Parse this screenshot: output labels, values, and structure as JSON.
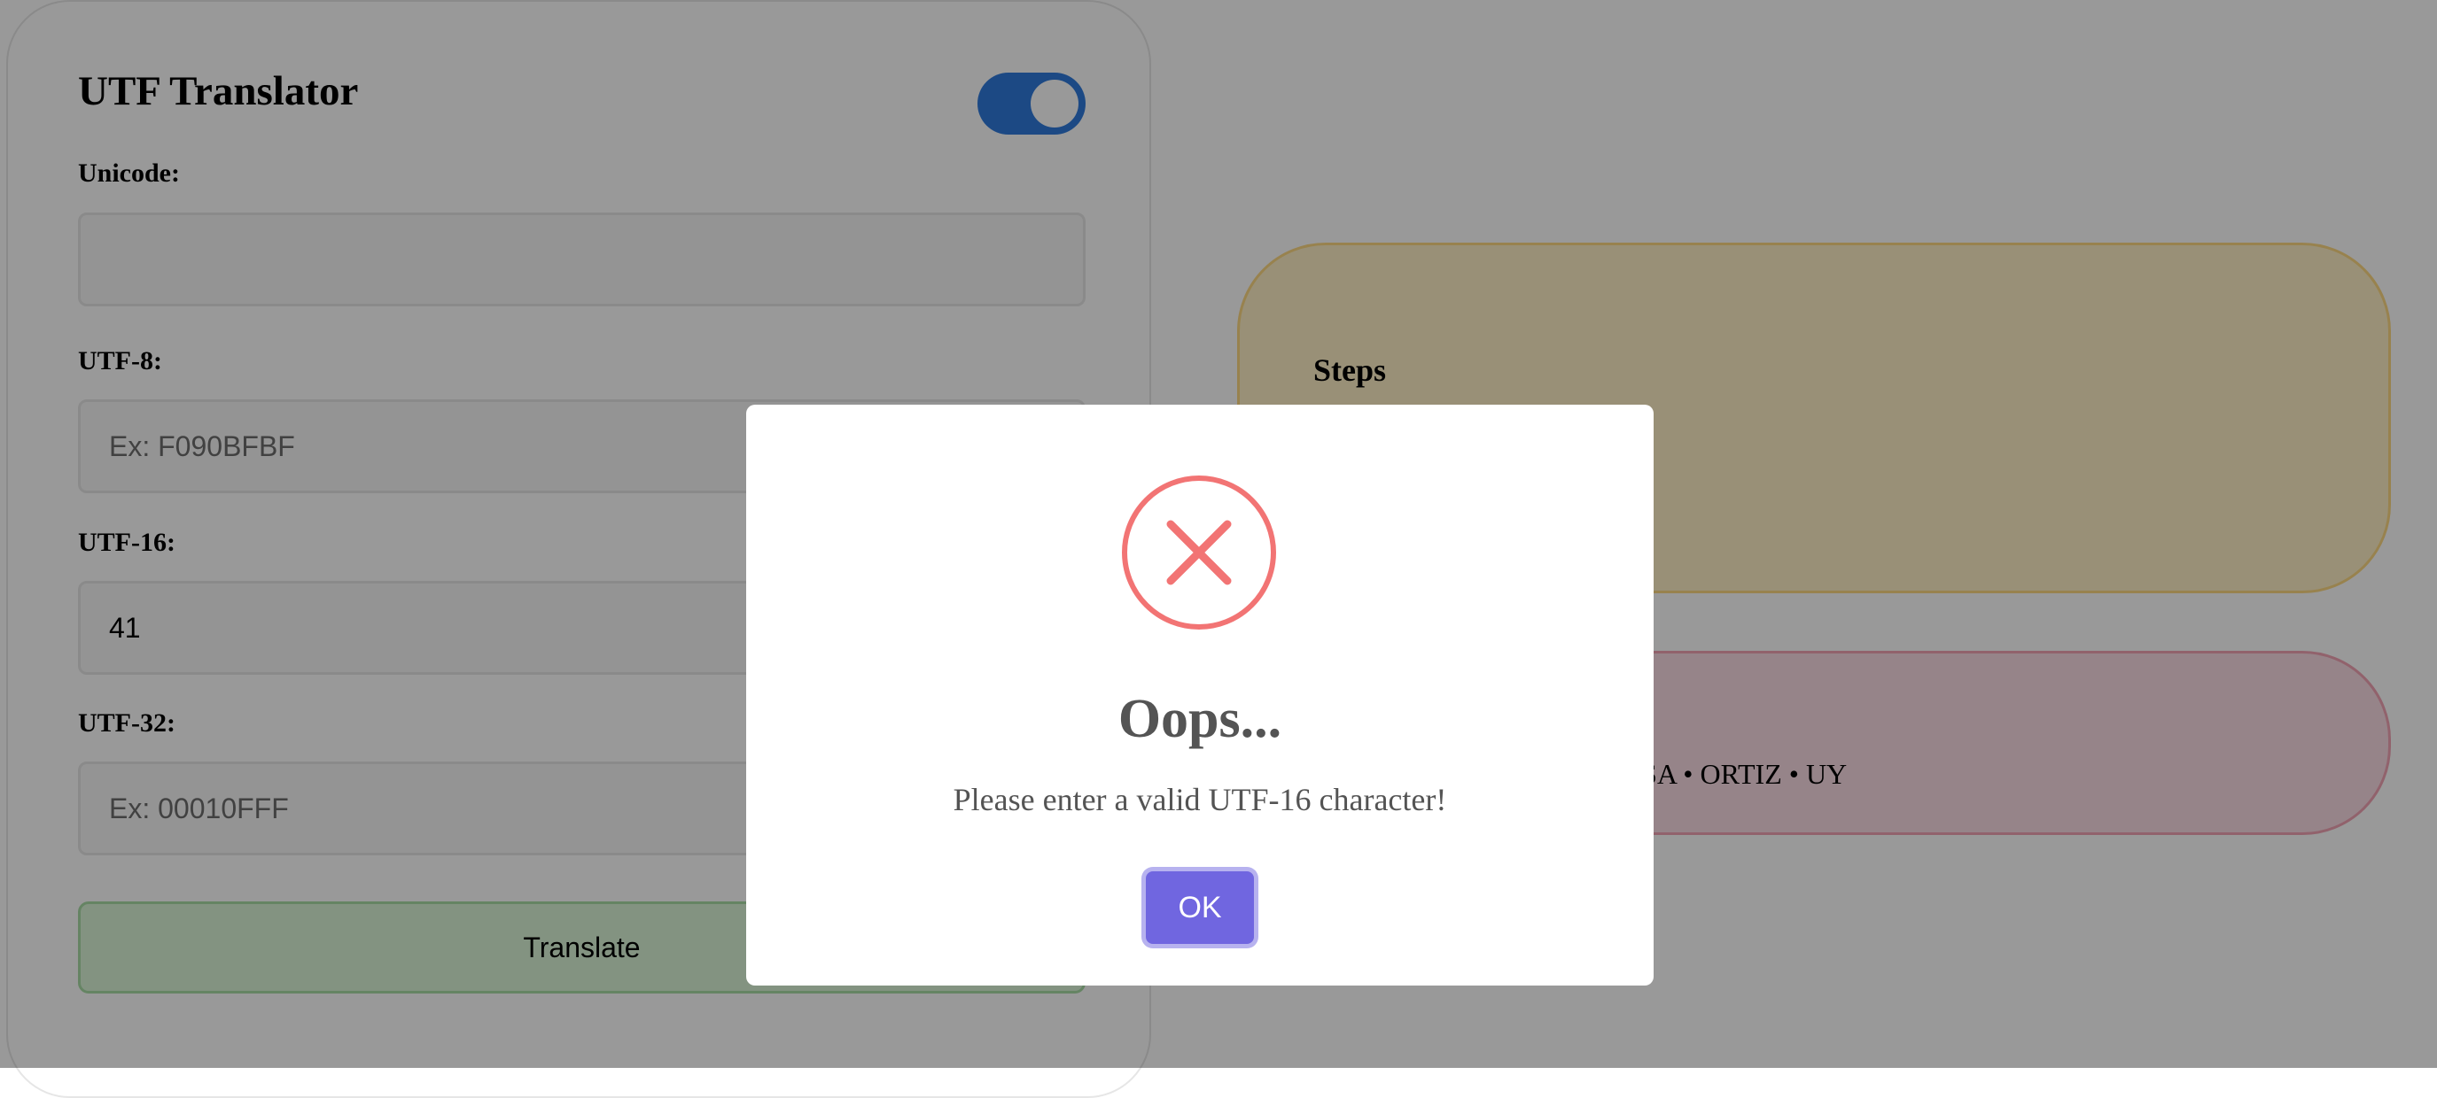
{
  "translator": {
    "title": "UTF Translator",
    "unicode_label": "Unicode:",
    "unicode_value": "",
    "unicode_placeholder": "",
    "utf8_label": "UTF-8:",
    "utf8_value": "",
    "utf8_placeholder": "Ex: F090BFBF",
    "utf16_label": "UTF-16:",
    "utf16_value": "41",
    "utf32_label": "UTF-32:",
    "utf32_value": "",
    "utf32_placeholder": "Ex: 00010FFF",
    "translate_label": "Translate",
    "toggle_state": "on"
  },
  "steps": {
    "title": "Steps"
  },
  "credits": {
    "heading_visible_fragment": ")",
    "text_visible_fragment": "YSA • ORTIZ • UY"
  },
  "dialog": {
    "title": "Oops...",
    "message": "Please enter a valid UTF-16 character!",
    "ok_label": "OK",
    "icon": "error-x-circle-icon"
  },
  "colors": {
    "toggle_accent": "#2f7bdc",
    "translate_bg": "#dbf5d8",
    "steps_bg": "#fff1c7",
    "credits_bg": "#fadde5",
    "error_icon": "#f27474",
    "ok_button": "#7066e0"
  }
}
